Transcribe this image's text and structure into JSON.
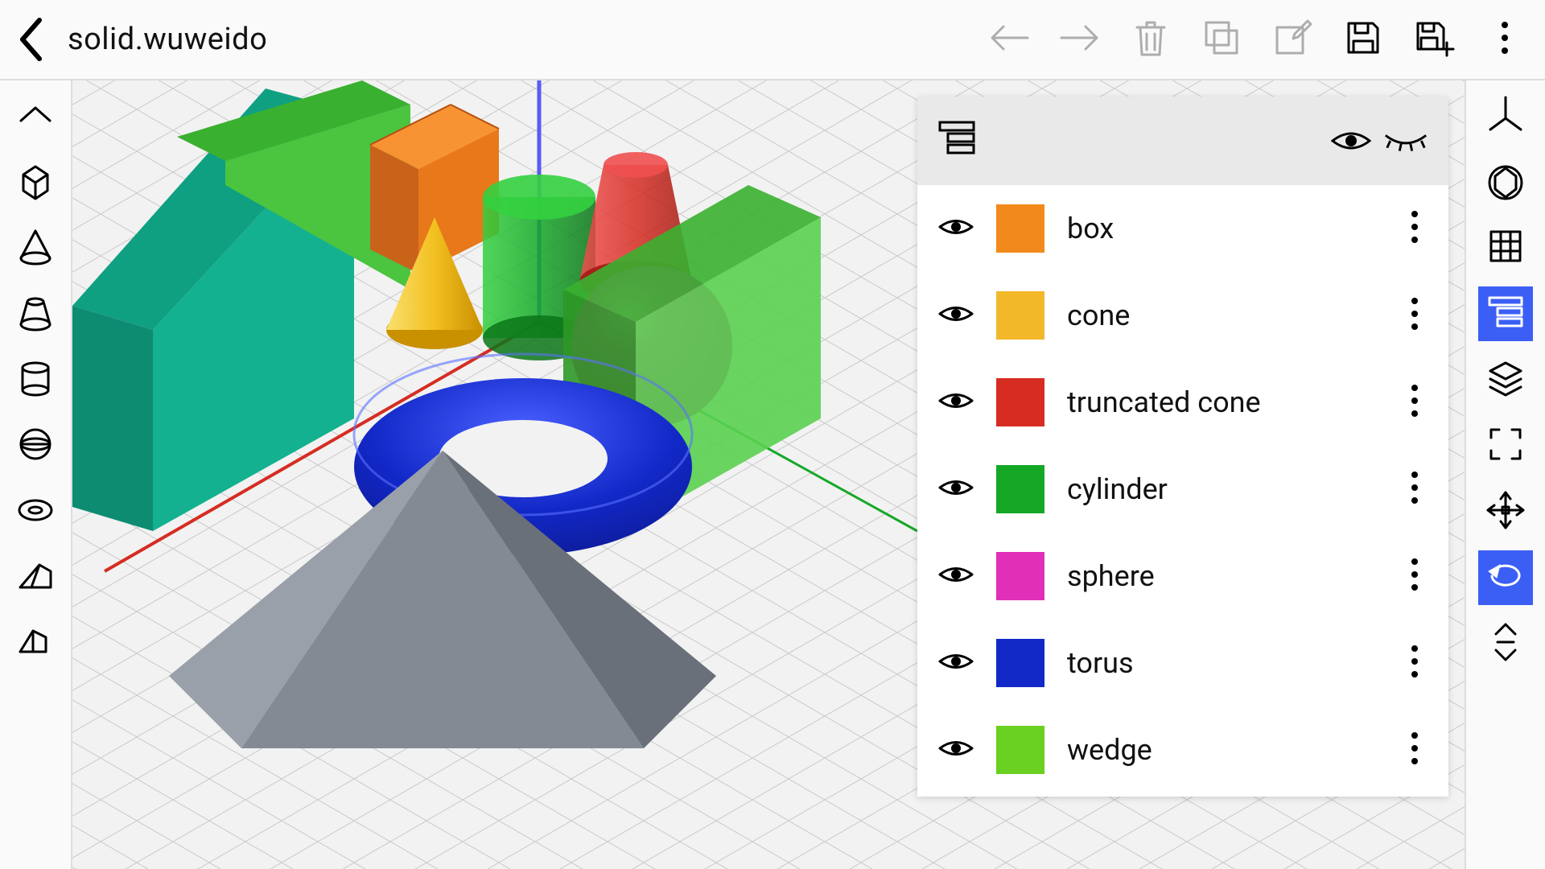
{
  "header": {
    "file_name": "solid.wuweido"
  },
  "left_tools": [
    {
      "name": "collapse-up",
      "icon": "chevron-up"
    },
    {
      "name": "box-tool",
      "icon": "cube"
    },
    {
      "name": "cone-tool",
      "icon": "cone"
    },
    {
      "name": "truncated-cone-tool",
      "icon": "frustum"
    },
    {
      "name": "cylinder-tool",
      "icon": "cylinder"
    },
    {
      "name": "sphere-tool",
      "icon": "sphere"
    },
    {
      "name": "torus-tool",
      "icon": "torus"
    },
    {
      "name": "wedge-tool",
      "icon": "wedge"
    },
    {
      "name": "prism-tool",
      "icon": "prism"
    }
  ],
  "right_tools": [
    {
      "name": "axes-tool",
      "icon": "axes",
      "active": false
    },
    {
      "name": "fit-view-tool",
      "icon": "fit-box",
      "active": false
    },
    {
      "name": "grid-tool",
      "icon": "grid",
      "active": false
    },
    {
      "name": "layers-tool",
      "icon": "layers-panel",
      "active": true
    },
    {
      "name": "stack-tool",
      "icon": "stack",
      "active": false
    },
    {
      "name": "focus-tool",
      "icon": "focus-corners",
      "active": false
    },
    {
      "name": "move-tool",
      "icon": "move-arrows",
      "active": false
    },
    {
      "name": "rotate-tool",
      "icon": "rotate",
      "active": true
    },
    {
      "name": "expand-tool",
      "icon": "expand-vert",
      "active": false
    }
  ],
  "topbar_actions": [
    {
      "name": "undo-button",
      "icon": "arrow-left",
      "disabled": true
    },
    {
      "name": "redo-button",
      "icon": "arrow-right",
      "disabled": true
    },
    {
      "name": "delete-button",
      "icon": "trash",
      "disabled": true
    },
    {
      "name": "duplicate-button",
      "icon": "duplicate",
      "disabled": true
    },
    {
      "name": "edit-button",
      "icon": "edit-square",
      "disabled": true
    },
    {
      "name": "save-button",
      "icon": "save",
      "disabled": false
    },
    {
      "name": "save-as-button",
      "icon": "save-plus",
      "disabled": false
    },
    {
      "name": "menu-button",
      "icon": "more-vert",
      "disabled": false
    }
  ],
  "layers": [
    {
      "label": "box",
      "color": "#f28a1b"
    },
    {
      "label": "cone",
      "color": "#f2b82a"
    },
    {
      "label": "truncated cone",
      "color": "#d62c22"
    },
    {
      "label": "cylinder",
      "color": "#14a826"
    },
    {
      "label": "sphere",
      "color": "#e030b8"
    },
    {
      "label": "torus",
      "color": "#1228c7"
    },
    {
      "label": "wedge",
      "color": "#6ad022"
    }
  ],
  "colors": {
    "active": "#3b5ff5"
  }
}
